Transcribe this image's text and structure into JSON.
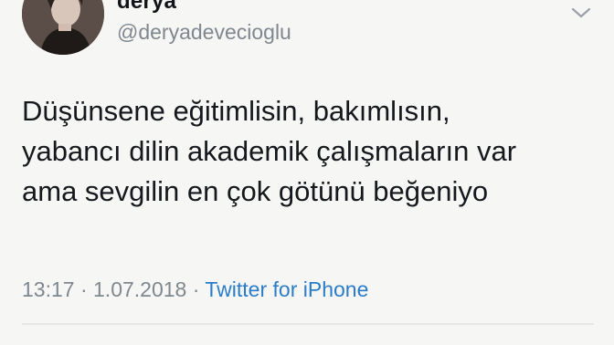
{
  "user": {
    "display_name": "derya",
    "handle": "@deryadevecioglu"
  },
  "tweet": {
    "lines": [
      "Düşünsene eğitimlisin, bakımlısın,",
      "yabancı dilin akademik çalışmaların var",
      "ama sevgilin en çok götünü beğeniyo"
    ],
    "time": "13:17",
    "separator": "·",
    "date": "1.07.2018",
    "source": "Twitter for iPhone"
  },
  "icons": {
    "caret": "chevron-down-icon",
    "avatar": "profile-photo"
  },
  "colors": {
    "link": "#2b7cc9",
    "muted": "#7f878f",
    "text": "#15181c"
  }
}
